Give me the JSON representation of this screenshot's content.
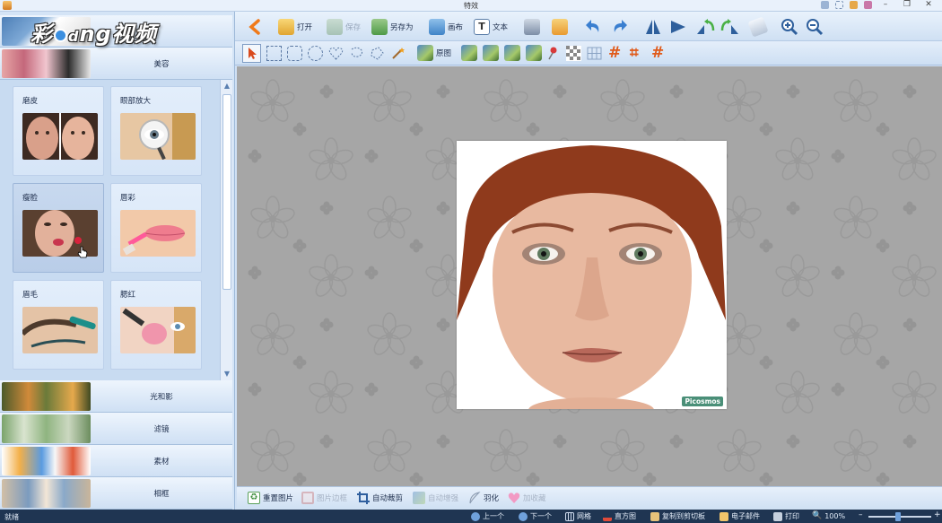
{
  "window": {
    "title": "特效"
  },
  "watermark": {
    "text_left": "彩",
    "text_right": "ng视频",
    "text_mid": "d"
  },
  "left_panel": {
    "categories_top": [
      {
        "id": "unknown-top",
        "label": ""
      },
      {
        "id": "beauty",
        "label": "美容"
      }
    ],
    "effects": [
      {
        "label": "磨皮"
      },
      {
        "label": "眼部放大"
      },
      {
        "label": "瘦脸"
      },
      {
        "label": "唇彩"
      },
      {
        "label": "眉毛"
      },
      {
        "label": "腮红"
      }
    ],
    "categories_bottom": [
      {
        "label": "光和影"
      },
      {
        "label": "滤镜"
      },
      {
        "label": "素材"
      },
      {
        "label": "相框"
      }
    ]
  },
  "toolbar1": {
    "open": "打开",
    "save": "保存",
    "save_as": "另存为",
    "canvas": "画布",
    "text": "文本"
  },
  "toolbar2": {
    "original": "原图"
  },
  "photo": {
    "watermark": "Picosmos"
  },
  "bottom_toolbar": {
    "redraw": "重置图片",
    "border": "图片边框",
    "auto_crop": "自动裁剪",
    "auto_enhance": "自动增强",
    "feather": "羽化",
    "favorites": "加收藏"
  },
  "statusbar": {
    "status": "就绪",
    "prev": "上一个",
    "next": "下一个",
    "grid": "网格",
    "histogram": "直方图",
    "copy_clipboard": "复制到剪切板",
    "email": "电子邮件",
    "print": "打印",
    "zoom": "100%"
  },
  "colors": {
    "accent": "#3b8fe0",
    "statusbar": "#1f3552",
    "canvas": "#a6a6a6"
  }
}
